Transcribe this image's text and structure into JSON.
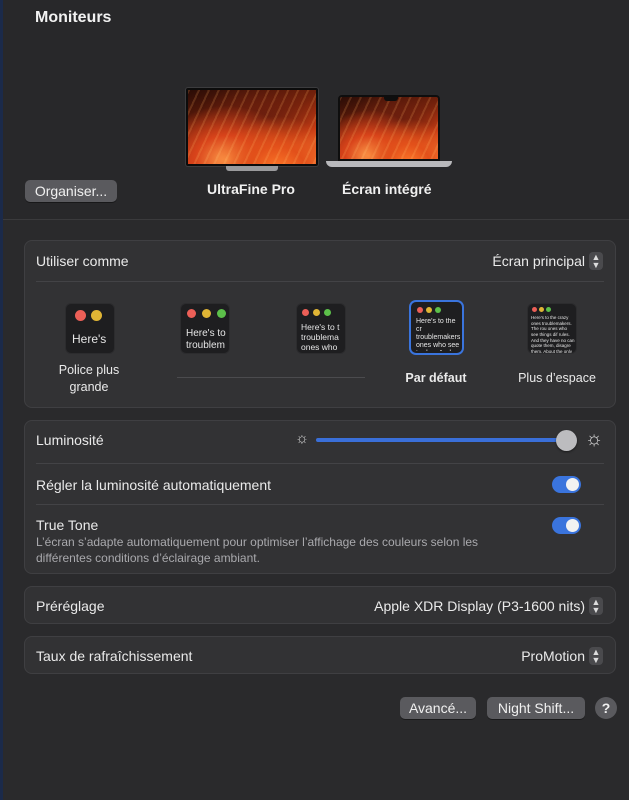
{
  "window": {
    "title": "Moniteurs"
  },
  "monitors": [
    {
      "name": "UltraFine Pro"
    },
    {
      "name": "Écran intégré"
    }
  ],
  "arrange_button": "Organiser...",
  "use_as": {
    "label": "Utiliser comme",
    "value": "Écran principal"
  },
  "resolutions": {
    "thumb_title": "Here's",
    "thumb_text_short": "Here's to troublem",
    "thumb_text_medium": "Here's to t troublema ones who",
    "thumb_text_default": "Here's to the cr troublemakers. ones who see t rules. And they",
    "thumb_text_space": "Here's to the crazy ones troublemakers. The rou ones who see things dif rules. And they have no can quote them, disagre them. About the only th Because they change th",
    "options": [
      {
        "label": "Police plus grande",
        "selected": false
      },
      {
        "label": "",
        "selected": false
      },
      {
        "label": "",
        "selected": false
      },
      {
        "label": "Par défaut",
        "selected": true
      },
      {
        "label": "Plus d’espace",
        "selected": false
      }
    ]
  },
  "brightness": {
    "label": "Luminosité",
    "level": 0.95
  },
  "auto_brightness": {
    "label": "Régler la luminosité automatiquement",
    "on": true
  },
  "true_tone": {
    "label": "True Tone",
    "description": "L’écran s’adapte automatiquement pour optimiser l’affichage des couleurs selon les différentes conditions d’éclairage ambiant.",
    "on": true
  },
  "preset": {
    "label": "Préréglage",
    "value": "Apple XDR Display (P3-1600 nits)"
  },
  "refresh_rate": {
    "label": "Taux de rafraîchissement",
    "value": "ProMotion"
  },
  "buttons": {
    "advanced": "Avancé...",
    "night_shift": "Night Shift...",
    "help": "?"
  },
  "colors": {
    "accent": "#3a74dd",
    "background": "#2a2a2c",
    "card": "#323234"
  },
  "icons": {
    "stepper": "up-down-chevron-icon",
    "brightness_low": "sun-small-icon",
    "brightness_high": "sun-large-icon"
  }
}
